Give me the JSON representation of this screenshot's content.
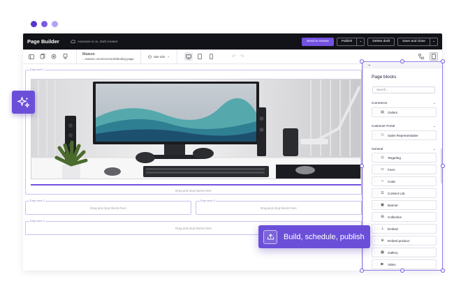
{
  "colors": {
    "accent": "#7352e0",
    "dot1": "#5b36c9",
    "dot2": "#7b5be0",
    "dot3": "#b3a3f1",
    "topbar_bg": "#121318"
  },
  "topbar": {
    "title": "Page Builder",
    "autosave": "Autosave is on, draft created",
    "send_review": "Send to review",
    "publish": "Publish",
    "delete_draft": "Delete draft",
    "save_close": "Save and close"
  },
  "toolbar": {
    "site_name": "Maison",
    "site_url": "...maison.commercetools/landing-page",
    "site_info": "Site info"
  },
  "canvas": {
    "zone1_label": "Drop zone 1",
    "zone2_label": "Drop zone 2",
    "zone3_label": "Drop zone 3",
    "zone4_label": "Drop zone 4",
    "drop_text": "Drag and drop blocks here"
  },
  "panel": {
    "title": "Page blocks",
    "search_placeholder": "Search...",
    "categories": [
      {
        "name": "Commerce",
        "items": [
          {
            "label": "Orders",
            "icon": "orders-icon"
          }
        ]
      },
      {
        "name": "Customer Portal",
        "items": [
          {
            "label": "Sales Representative",
            "icon": "user-icon"
          }
        ]
      },
      {
        "name": "General",
        "items": [
          {
            "label": "Targeting",
            "icon": "target-icon"
          },
          {
            "label": "Form",
            "icon": "form-icon"
          },
          {
            "label": "Code",
            "icon": "code-icon"
          },
          {
            "label": "Content List",
            "icon": "list-icon"
          },
          {
            "label": "Banner",
            "icon": "banner-icon"
          },
          {
            "label": "Collection",
            "icon": "grid-icon"
          },
          {
            "label": "Embed",
            "icon": "embed-icon"
          },
          {
            "label": "Embed product",
            "icon": "product-icon"
          },
          {
            "label": "Gallery",
            "icon": "gallery-icon"
          },
          {
            "label": "Video",
            "icon": "video-icon"
          }
        ]
      }
    ]
  },
  "toast": {
    "label": "Build, schedule, publish"
  }
}
